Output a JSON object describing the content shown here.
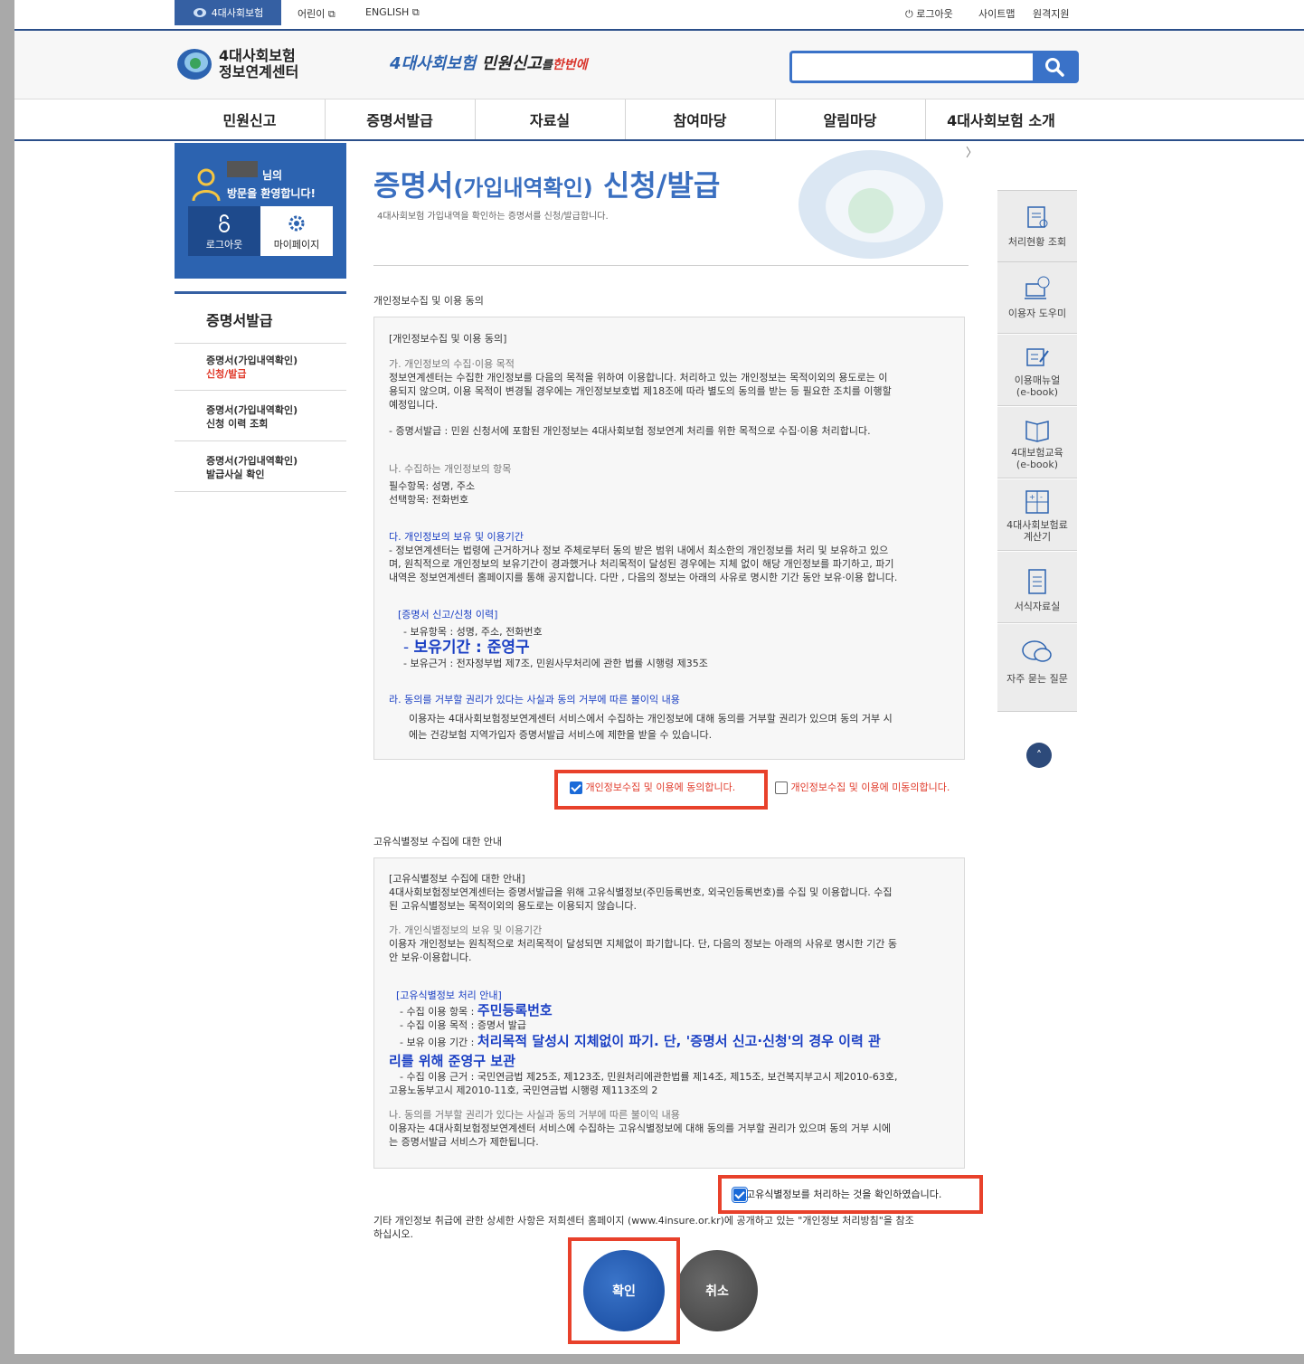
{
  "util": {
    "home": "4대사회보험",
    "kids": "어린이",
    "english": "ENGLISH",
    "logout": "로그아웃",
    "sitemap": "사이트맵",
    "remote": "원격지원"
  },
  "logo": {
    "line1": "4대사회보험",
    "line2": "정보연계센터"
  },
  "slogan": {
    "part1": "4대사회보험",
    "part2": "민원신고",
    "part3": "를",
    "part4": "한번에"
  },
  "search": {
    "placeholder": ""
  },
  "gnb": [
    "민원신고",
    "증명서발급",
    "자료실",
    "참여마당",
    "알림마당",
    "4대사회보험 소개"
  ],
  "welcome": {
    "suffix": "님의",
    "line2": "방문을 환영합니다!",
    "logout": "로그아웃",
    "mypage": "마이페이지"
  },
  "lnb": {
    "title": "증명서발급",
    "items": [
      {
        "l1": "증명서(가입내역확인)",
        "l2": "신청/발급"
      },
      {
        "l1": "증명서(가입내역확인)",
        "l2": "신청 이력 조회"
      },
      {
        "l1": "증명서(가입내역확인)",
        "l2": "발급사실 확인"
      }
    ]
  },
  "page": {
    "title_a": "증명서",
    "title_b": "(가입내역확인)",
    "title_c": " 신청/발급",
    "subtitle": "4대사회보험 가입내역을 확인하는 증명서를 신청/발급합니다."
  },
  "section1": {
    "heading": "개인정보수집 및 이용 동의",
    "box_title": "[개인정보수집 및 이용 동의]",
    "a_head": "가. 개인정보의 수집·이용 목적",
    "a_body1": "정보연계센터는 수집한 개인정보를 다음의 목적을 위하여 이용합니다. 처리하고 있는 개인정보는 목적이외의 용도로는 이",
    "a_body2": "용되지 않으며, 이용 목적이 변경될 경우에는 개인정보보호법 제18조에 따라 별도의 동의를 받는 등 필요한 조치를 이행할",
    "a_body3": "예정입니다.",
    "a_body4": "- 증명서발급 : 민원 신청서에 포함된 개인정보는 4대사회보험 정보연계 처리를 위한 목적으로 수집·이용 처리합니다.",
    "b_head": "나. 수집하는 개인정보의 항목",
    "b_body1": "필수항목: 성명, 주소",
    "b_body2": "선택항목: 전화번호",
    "c_head": "다. 개인정보의 보유 및 이용기간",
    "c_body1": "- 정보연계센터는 법령에 근거하거나 정보 주체로부터 동의 받은 범위 내에서 최소한의 개인정보를 처리 및 보유하고 있으",
    "c_body2": "며, 원칙적으로 개인정보의 보유기간이 경과했거나 처리목적이 달성된 경우에는 지체 없이 해당 개인정보를 파기하고, 파기",
    "c_body3": "내역은 정보연계센터 홈페이지를 통해 공지합니다. 다만 , 다음의 정보는 아래의 사유로 명시한 기간 동안 보유·이용 합니다.",
    "c_sub": "[증명서 신고/신청 이력]",
    "c_sub1": "- 보유항목 : 성명, 주소, 전화번호",
    "c_sub2_a": "- ",
    "c_sub2_b": "보유기간 : 준영구",
    "c_sub3": "- 보유근거 : 전자정부법 제7조, 민원사무처리에 관한 법률 시행령 제35조",
    "d_head": "라. 동의를 거부할 권리가 있다는 사실과 동의 거부에 따른 불이익 내용",
    "d_body1": "이용자는 4대사회보험정보연계센터 서비스에서 수집하는 개인정보에 대해 동의를 거부할 권리가 있으며 동의 거부 시",
    "d_body2": "에는 건강보험 지역가입자 증명서발급 서비스에 제한을 받을 수 있습니다.",
    "agree": "개인정보수집 및 이용에 동의합니다.",
    "disagree": "개인정보수집 및 이용에 미동의합니다."
  },
  "section2": {
    "heading": "고유식별정보 수집에 대한 안내",
    "box_title": "[고유식별정보 수집에 대한 안내]",
    "intro1": "4대사회보험정보연계센터는 증명서발급을 위해 고유식별정보(주민등록번호, 외국인등록번호)를 수집 및 이용합니다. 수집",
    "intro2": "된 고유식별정보는 목적이외의 용도로는 이용되지 않습니다.",
    "a_head": "가. 개인식별정보의 보유 및 이용기간",
    "a_body1": "이용자 개인정보는 원칙적으로 처리목적이 달성되면 지체없이 파기합니다. 단, 다음의 정보는 아래의 사유로 명시한 기간 동",
    "a_body2": "안 보유·이용합니다.",
    "sub": "[고유식별정보 처리 안내]",
    "s1_label": "- 수집 이용 항목 : ",
    "s1_val": "주민등록번호",
    "s2": "- 수집 이용 목적 : 증명서 발급",
    "s3_label": "- 보유 이용 기간 : ",
    "s3_val1": "처리목적 달성시 지체없이 파기. 단, '증명서 신고·신청'의 경우 이력 관",
    "s3_val2": "리를 위해 준영구 보관",
    "s4_1": "- 수집 이용 근거 : 국민연금법 제25조, 제123조, 민원처리에관한법률 제14조, 제15조, 보건복지부고시 제2010-63호,",
    "s4_2": "고용노동부고시 제2010-11호, 국민연금법 시행령 제113조의 2",
    "b_head": "나. 동의를 거부할 권리가 있다는 사실과 동의 거부에 따른 불이익 내용",
    "b_body1": "이용자는 4대사회보험정보연계센터 서비스에 수집하는 고유식별정보에 대해 동의를 거부할 권리가 있으며 동의 거부 시에",
    "b_body2": "는 증명서발급 서비스가 제한됩니다.",
    "confirm": "고유식별정보를 처리하는 것을 확인하였습니다."
  },
  "footnote1": "기타 개인정보 취급에 관한 상세한 사항은 저희센터 홈페이지 (www.4insure.or.kr)에 공개하고 있는 \"개인정보 처리방침\"을 참조",
  "footnote2": "하십시오.",
  "buttons": {
    "ok": "확인",
    "cancel": "취소"
  },
  "quick": [
    {
      "l1": "처리현황 조회",
      "l2": "",
      "icon": "clipboard-search-icon"
    },
    {
      "l1": "이용자 도우미",
      "l2": "",
      "icon": "computer-help-icon"
    },
    {
      "l1": "이용매뉴얼",
      "l2": "(e-book)",
      "icon": "manual-edit-icon"
    },
    {
      "l1": "4대보험교육",
      "l2": "(e-book)",
      "icon": "book-icon"
    },
    {
      "l1": "4대사회보험료",
      "l2": "계산기",
      "icon": "calculator-icon"
    },
    {
      "l1": "서식자료실",
      "l2": "",
      "icon": "document-icon"
    },
    {
      "l1": "자주 묻는 질문",
      "l2": "",
      "icon": "chat-bubble-icon"
    }
  ]
}
